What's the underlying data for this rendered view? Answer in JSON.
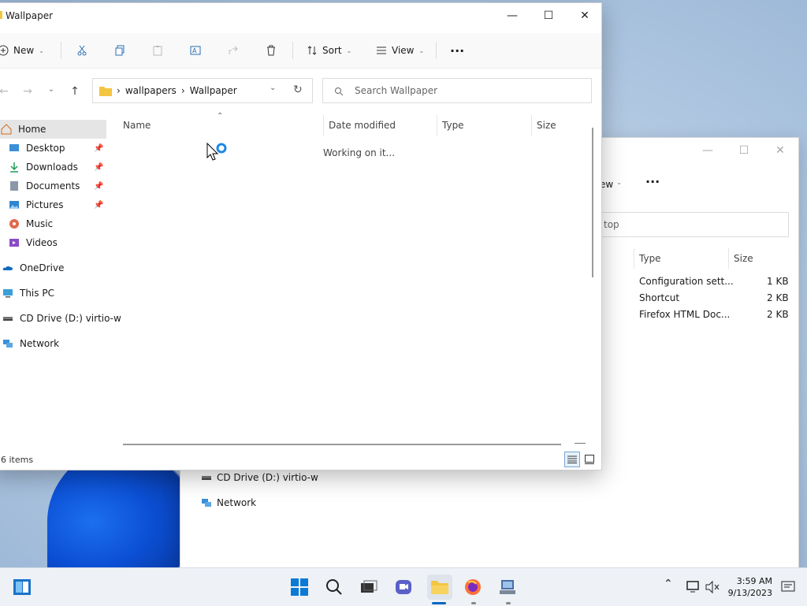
{
  "front_window": {
    "title": "Wallpaper",
    "toolbar": {
      "new_label": "New",
      "sort_label": "Sort",
      "view_label": "View",
      "more_label": "···"
    },
    "address": {
      "crumbs": [
        "wallpapers",
        "Wallpaper"
      ]
    },
    "search": {
      "placeholder": "Search Wallpaper"
    },
    "sidebar": {
      "items": [
        {
          "label": "Home",
          "icon": "home-icon"
        },
        {
          "label": "Desktop",
          "icon": "desktop-icon",
          "pinned": true
        },
        {
          "label": "Downloads",
          "icon": "download-icon",
          "pinned": true
        },
        {
          "label": "Documents",
          "icon": "documents-icon",
          "pinned": true
        },
        {
          "label": "Pictures",
          "icon": "pictures-icon",
          "pinned": true
        },
        {
          "label": "Music",
          "icon": "music-icon"
        },
        {
          "label": "Videos",
          "icon": "videos-icon"
        },
        {
          "label": "OneDrive",
          "icon": "onedrive-icon"
        },
        {
          "label": "This PC",
          "icon": "this-pc-icon"
        },
        {
          "label": "CD Drive (D:) virtio-w",
          "icon": "cd-drive-icon"
        },
        {
          "label": "Network",
          "icon": "network-icon"
        }
      ]
    },
    "columns": [
      "Name",
      "Date modified",
      "Type",
      "Size"
    ],
    "loading_text": "Working on it...",
    "status": "6 items"
  },
  "back_window": {
    "toolbar_partial": "ew",
    "more_label": "···",
    "search_partial": "top",
    "columns": [
      "Type",
      "Size"
    ],
    "rows": [
      {
        "type": "Configuration sett...",
        "size": "1 KB"
      },
      {
        "type": "Shortcut",
        "size": "2 KB"
      },
      {
        "type": "Firefox HTML Doc...",
        "size": "2 KB"
      }
    ],
    "nav_items": [
      "CD Drive (D:) virtio-w",
      "Network"
    ]
  },
  "taskbar": {
    "time": "3:59 AM",
    "date": "9/13/2023"
  },
  "colors": {
    "accent": "#0067c0",
    "folder": "#f4c542"
  }
}
